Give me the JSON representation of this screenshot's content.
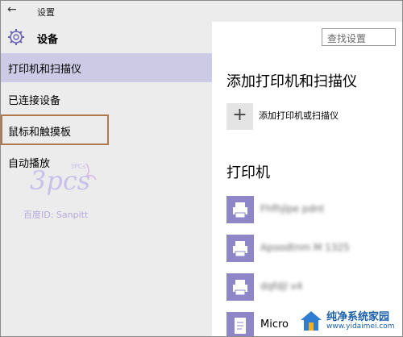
{
  "titlebar": {
    "back_symbol": "←",
    "title": "设置"
  },
  "header": {
    "icon": "gear-icon",
    "title": "设备"
  },
  "search": {
    "placeholder": "查找设置"
  },
  "nav": [
    {
      "label": "打印机和扫描仪",
      "active": true
    },
    {
      "label": "已连接设备",
      "active": false
    },
    {
      "label": "鼠标和触摸板",
      "active": false,
      "highlighted": true
    },
    {
      "label": "自动播放",
      "active": false
    }
  ],
  "watermark": {
    "text": "百度ID: Sanpitt"
  },
  "main": {
    "add_section_title": "添加打印机和扫描仪",
    "add_button_symbol": "+",
    "add_button_label": "添加打印机或扫描仪",
    "printers_title": "打印机",
    "devices": [
      {
        "name": "Fhfhjlpe pdnt",
        "blurred": true
      },
      {
        "name": "Apoodtnm M 1325",
        "blurred": true
      },
      {
        "name": "dqfdjl v4",
        "blurred": true
      },
      {
        "name": "Micro",
        "blurred": false
      }
    ]
  },
  "logo": {
    "name": "纯净系统家园",
    "url": "www.yidaimei.com"
  },
  "colors": {
    "nav_active": "#cdcae6",
    "highlight_border": "#b27a4a",
    "printer_icon": "#8e86c7"
  }
}
